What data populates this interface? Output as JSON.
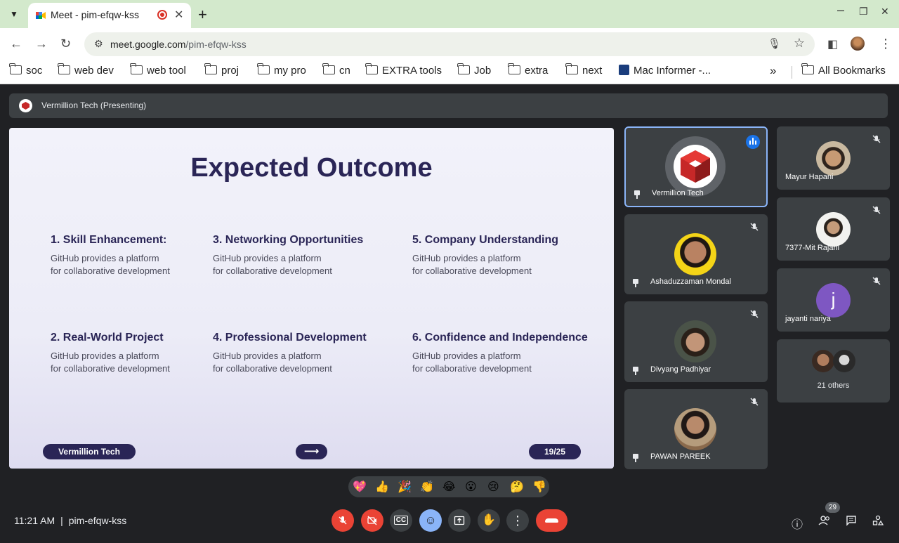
{
  "browser": {
    "tab_title": "Meet - pim-efqw-kss",
    "url_host": "meet.google.com",
    "url_path": "/pim-efqw-kss",
    "bookmarks": [
      "soc",
      "web dev",
      "web tool",
      "proj",
      "my pro",
      "cn",
      "EXTRA tools",
      "Job",
      "extra",
      "next",
      "Mac Informer -...",
      "All Bookmarks"
    ]
  },
  "meet": {
    "presenting_label": "Vermillion Tech (Presenting)",
    "slide": {
      "title": "Expected Outcome",
      "items": [
        {
          "title": "1. Skill Enhancement:",
          "desc": "GitHub provides a platform for collaborative development"
        },
        {
          "title": "3. Networking Opportunities",
          "desc": "GitHub provides a platform for collaborative development"
        },
        {
          "title": "5. Company Understanding",
          "desc": "GitHub provides a platform for collaborative development"
        },
        {
          "title": "2. Real-World Project",
          "desc": "GitHub provides a platform for collaborative development"
        },
        {
          "title": "4. Professional Development",
          "desc": "GitHub provides a platform for collaborative development"
        },
        {
          "title": "6. Confidence and Independence",
          "desc": "GitHub provides a platform for collaborative development"
        }
      ],
      "footer_brand": "Vermillion Tech",
      "page": "19/25"
    },
    "participants": {
      "presenter": "Vermillion Tech",
      "list": [
        "Ashaduzzaman Mondal",
        "Divyang Padhiyar",
        "PAWAN PAREEK",
        "Mayur Hapani",
        "7377-Mit Rajani",
        "jayanti nariya"
      ],
      "jayanti_initial": "j",
      "others": "21 others"
    },
    "reactions": [
      "💖",
      "👍",
      "🎉",
      "👏",
      "😂",
      "😮",
      "😢",
      "🤔",
      "👎"
    ],
    "time": "11:21 AM",
    "meeting_code": "pim-efqw-kss",
    "participant_count": "29",
    "colors": {
      "accent_blue": "#1a73e8",
      "end_red": "#ea4335",
      "slide_navy": "#2a2556"
    }
  }
}
